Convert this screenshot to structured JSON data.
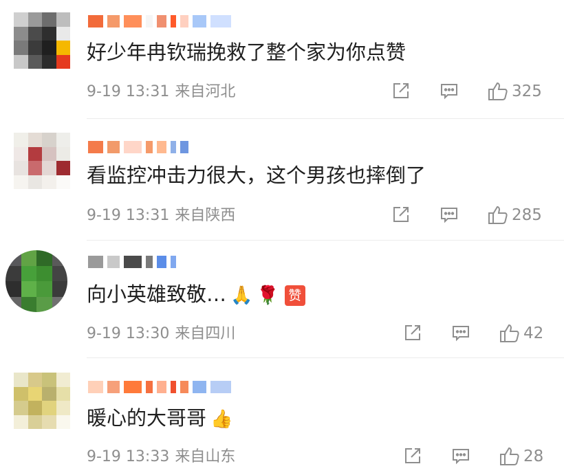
{
  "comments": [
    {
      "text": "好少年冉钦瑞挽救了整个家为你点赞",
      "date": "9-19 13:31",
      "location": "来自河北",
      "likes": "325",
      "avatar_colors": [
        "#cfcfcf",
        "#9a9a9a",
        "#6d6d6d",
        "#bdbdbd",
        "#8c8c8c",
        "#4b4b4b",
        "#2e2e2e",
        "#e9e9e9",
        "#7a7a7a",
        "#3b3b3b",
        "#1f1f1f",
        "#f5b800",
        "#c8c8c8",
        "#5a5a5a",
        "#2c2c2c",
        "#e53a1e"
      ],
      "name_colors": [
        "#f26b3a",
        "#f59a6a",
        "#ff8f5a",
        "#f5f5f5",
        "#f09070",
        "#ff5a2a",
        "#ffd0c0",
        "#a8c8f8",
        "#d0e0ff"
      ]
    },
    {
      "text": "看监控冲击力很大，这个男孩也摔倒了",
      "date": "9-19 13:31",
      "location": "来自陕西",
      "likes": "285",
      "avatar_colors": [
        "#f0efe9",
        "#e4dcd5",
        "#d7d2cc",
        "#eeeeea",
        "#efe8e6",
        "#b33b3f",
        "#d6c2c0",
        "#ecebe6",
        "#e8e3e0",
        "#c96a6d",
        "#e3d7d4",
        "#9e2b30",
        "#f6f4f0",
        "#e9e6e2",
        "#f3f0ec",
        "#fbfaf8"
      ],
      "name_colors": [
        "#f47b4a",
        "#f29a6a",
        "#ffd6c8",
        "#f59a6a",
        "#ffb98f",
        "#8fb0e8",
        "#6e96e0"
      ]
    },
    {
      "text": "向小英雄致敬…",
      "date": "9-19 13:30",
      "location": "来自四川",
      "likes": "42",
      "avatar_colors": [
        "#58585b",
        "#61a345",
        "#2f6a27",
        "#5a5a5a",
        "#3b3b3b",
        "#47a03a",
        "#3d8e30",
        "#444444",
        "#2e2e2e",
        "#5fb149",
        "#4a9a3a",
        "#3b3b3b",
        "#666666",
        "#3a7d2f",
        "#5a9c47",
        "#707070"
      ],
      "name_colors": [
        "#9a9a9a",
        "#c9c9c9",
        "#4a4a4a",
        "#7a7a7a",
        "#5b8de8",
        "#80a8ef"
      ],
      "extras": {
        "zan_label": "赞"
      }
    },
    {
      "text": "暖心的大哥哥",
      "date": "9-19 13:33",
      "location": "来自山东",
      "likes": "28",
      "avatar_colors": [
        "#e9e6c9",
        "#d8c98a",
        "#c9c27a",
        "#f1ecd2",
        "#cfc06a",
        "#e8d574",
        "#b9b06d",
        "#e6dfa8",
        "#d5cb8d",
        "#c2b25e",
        "#e1d37e",
        "#efe9c6",
        "#f3efd9",
        "#d9cf97",
        "#e6dcb0",
        "#faf8ee"
      ],
      "name_colors": [
        "#ffd0b8",
        "#f6a07a",
        "#ff7a3a",
        "#f57040",
        "#ffb090",
        "#f0502e",
        "#f68a5a",
        "#8fb5f0",
        "#b7cdf5"
      ]
    }
  ]
}
